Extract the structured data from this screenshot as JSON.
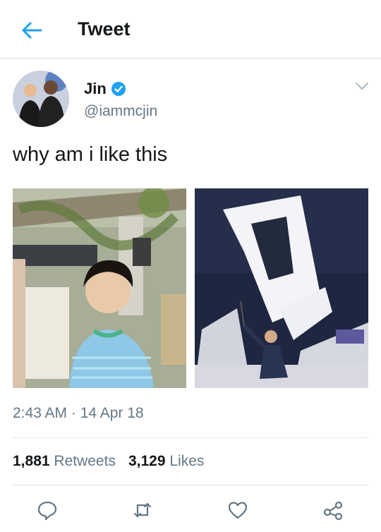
{
  "header": {
    "title": "Tweet",
    "back_icon": "back-arrow-icon"
  },
  "tweet": {
    "author_name": "Jin",
    "verified": true,
    "handle": "@iammcjin",
    "text": "why am i like this",
    "timestamp": "2:43 AM · 14 Apr 18",
    "retweets_count": "1,881",
    "retweets_label": "Retweets",
    "likes_count": "3,129",
    "likes_label": "Likes"
  },
  "actions": [
    "reply-icon",
    "retweet-icon",
    "like-icon",
    "share-icon"
  ],
  "colors": {
    "accent": "#1da1f2",
    "text": "#14171a",
    "secondary": "#657786",
    "divider": "#e1e8ed"
  }
}
